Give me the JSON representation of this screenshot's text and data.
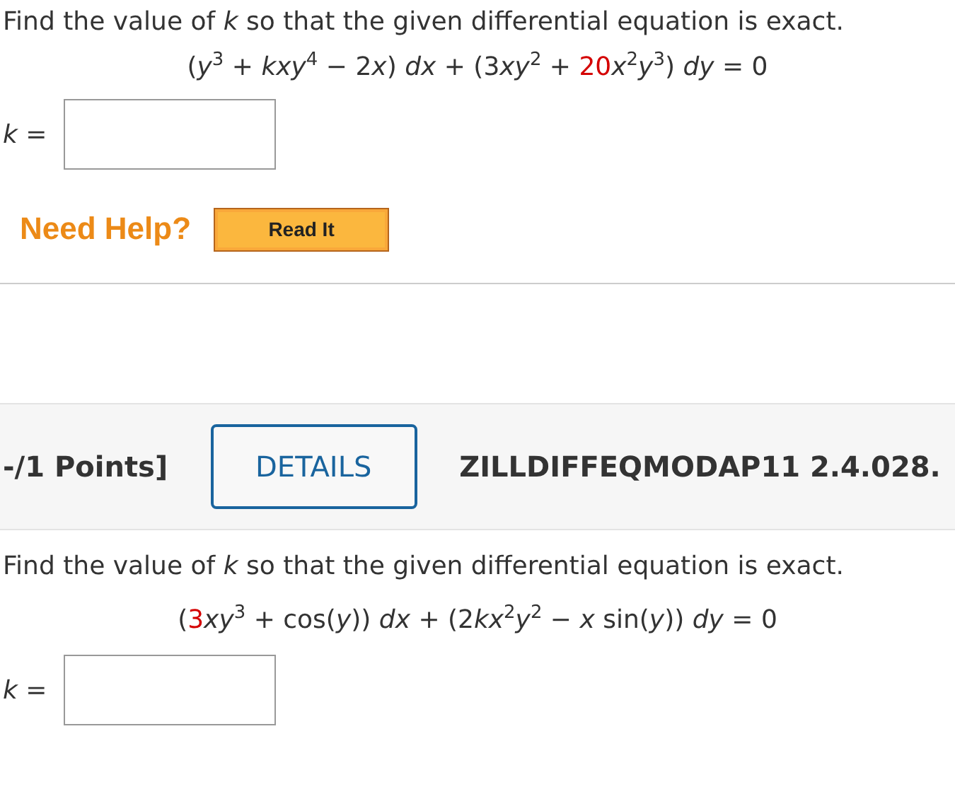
{
  "question_1": {
    "prompt": "Find the value of *k* so that the given differential equation is exact.",
    "equation": [
      {
        "text": "(*y*$^{3}$ + *kxy*$^{4}$ − 2",
        "highlight": false
      },
      {
        "text": "*x*) *dx* + (3",
        "highlight": false
      },
      {
        "text": "*xy*$^{2}$ + ",
        "highlight": false
      },
      {
        "text": "20",
        "highlight": true
      },
      {
        "text": "*x*$^{2}$*y*$^{3}$) *dy* = 0",
        "highlight": false
      }
    ],
    "answer_label": "*k* ="
  },
  "help": {
    "label": "Need Help?",
    "buttons": [
      "Read It"
    ]
  },
  "question_2": {
    "points": "-/1 Points]",
    "details_button": "DETAILS",
    "code": "ZILLDIFFEQMODAP11 2.4.028.",
    "prompt": "Find the value of *k* so that the given differential equation is exact.",
    "equation": [
      {
        "text": "(",
        "highlight": false
      },
      {
        "text": "3",
        "highlight": true
      },
      {
        "text": "*xy*$^{3}$ + cos(*y*)) *dx* + (2",
        "highlight": false
      },
      {
        "text": "*kx*$^{2}$*y*$^{2}$ − *x* sin(*y*)) *dy* = 0",
        "highlight": false
      }
    ],
    "answer_label": "*k* ="
  }
}
